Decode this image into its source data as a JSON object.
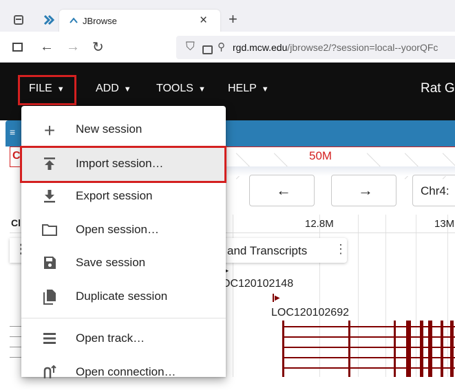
{
  "browser": {
    "tab_title": "JBrowse",
    "tab_close": "×",
    "new_tab": "+",
    "url_host": "rgd.mcw.edu",
    "url_path": "/jbrowse2/?session=local--yoorQFc"
  },
  "app_menu": {
    "file": "FILE",
    "add": "ADD",
    "tools": "TOOLS",
    "help": "HELP",
    "title": "Rat G"
  },
  "view": {
    "overview_label": "50M",
    "prev_label": "←",
    "next_label": "→",
    "locstring": "Chr4:",
    "panel_cut_label": "C",
    "track_header_cut": "Cl",
    "tick_1": "12.8M",
    "tick_2": "13M",
    "track_title": "and Transcripts",
    "track_menu": "⋮",
    "side_menu": "⋮",
    "gene_1": "OC120102148",
    "gene_2": "LOC120102692"
  },
  "file_menu": {
    "items": [
      {
        "label": "New session",
        "icon": "plus-icon"
      },
      {
        "label": "Import session…",
        "icon": "import-icon"
      },
      {
        "label": "Export session",
        "icon": "download-icon"
      },
      {
        "label": "Open session…",
        "icon": "folder-icon"
      },
      {
        "label": "Save session",
        "icon": "save-icon"
      },
      {
        "label": "Duplicate session",
        "icon": "duplicate-icon"
      },
      {
        "label": "Open track…",
        "icon": "track-icon"
      },
      {
        "label": "Open connection…",
        "icon": "connection-icon"
      }
    ]
  },
  "colors": {
    "app_bar": "#0f0f0f",
    "panel_header": "#2a7db4",
    "gene": "#800000",
    "highlight": "#d42020"
  }
}
